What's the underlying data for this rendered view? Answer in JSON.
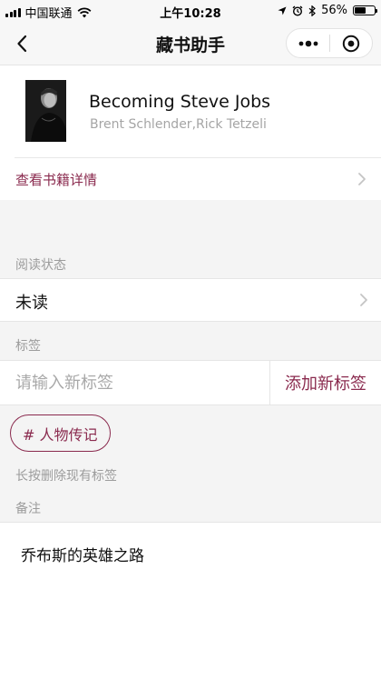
{
  "status_bar": {
    "carrier": "中国联通",
    "time": "上午10:28",
    "battery": "56%",
    "battery_level": 0.56
  },
  "nav": {
    "title": "藏书助手",
    "back_icon": "chevron-left-icon",
    "more_icon": "more-dots-icon",
    "close_icon": "record-circle-icon"
  },
  "book": {
    "title": "Becoming Steve Jobs",
    "authors": "Brent Schlender,Rick Tetzeli"
  },
  "details_link": "查看书籍详情",
  "reading_status": {
    "label": "阅读状态",
    "value": "未读"
  },
  "tags": {
    "label": "标签",
    "input_placeholder": "请输入新标签",
    "input_value": "",
    "add_button": "添加新标签",
    "items": [
      "# 人物传记"
    ],
    "hint": "长按删除现有标签"
  },
  "notes": {
    "label": "备注",
    "value": "乔布斯的英雄之路"
  },
  "colors": {
    "accent": "#8a2a4e",
    "muted_text": "#9c9c9c",
    "page_background": "#f4f4f4"
  }
}
